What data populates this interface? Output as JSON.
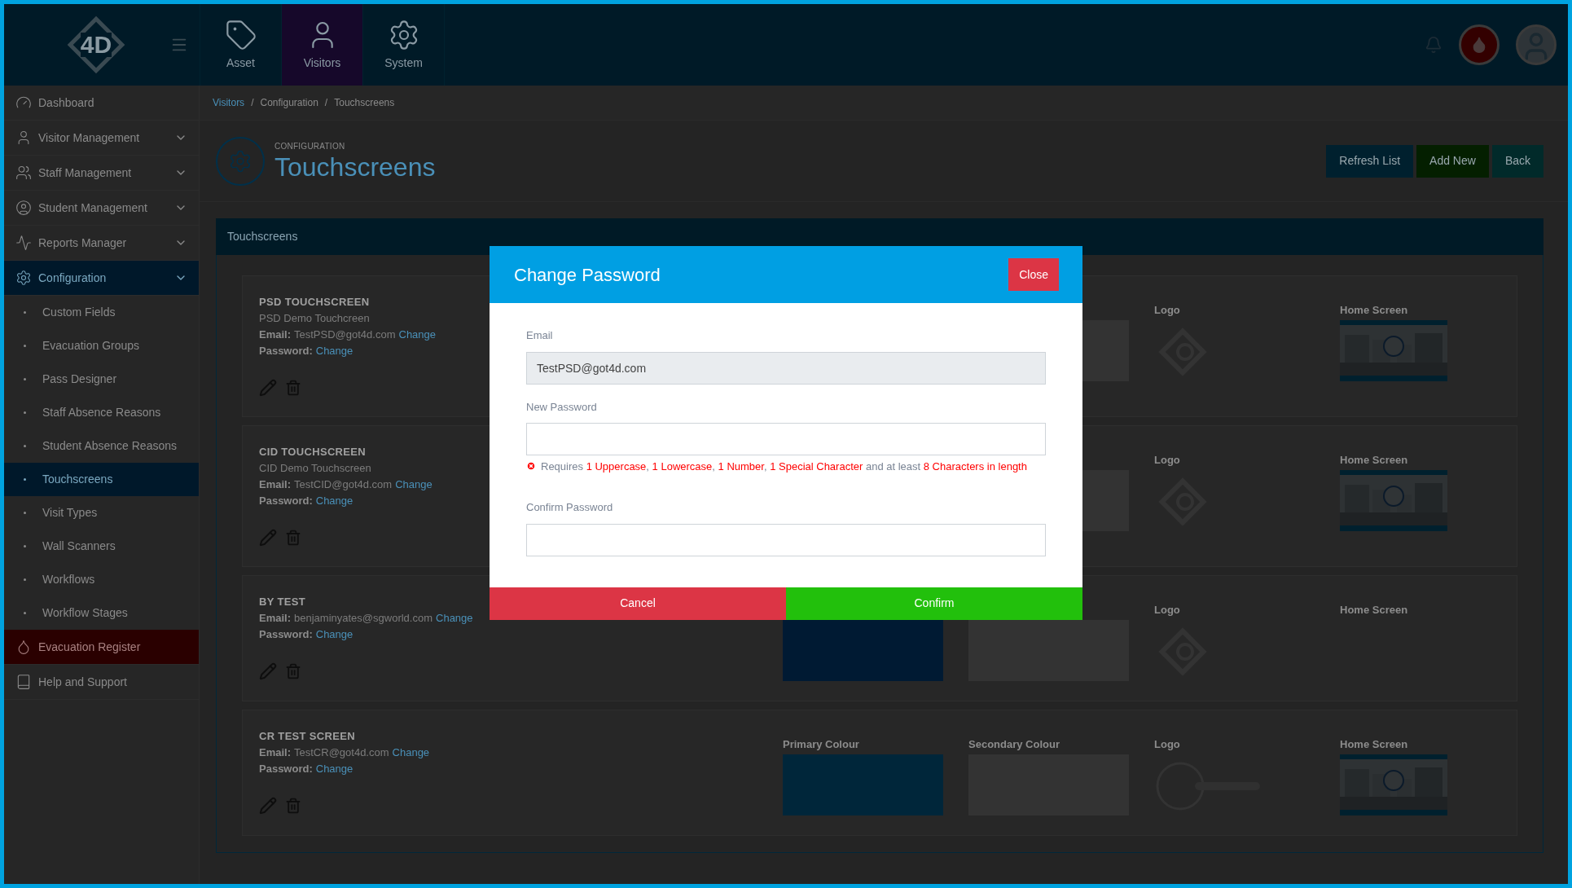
{
  "nav": {
    "logo_text": "4D",
    "tabs": [
      {
        "label": "Asset",
        "selected": false
      },
      {
        "label": "Visitors",
        "selected": true
      },
      {
        "label": "System",
        "selected": false
      }
    ]
  },
  "sidebar": {
    "items": [
      {
        "label": "Dashboard",
        "kind": "link",
        "selected": false
      },
      {
        "label": "Visitor Management",
        "kind": "group",
        "selected": false
      },
      {
        "label": "Staff Management",
        "kind": "group",
        "selected": false
      },
      {
        "label": "Student Management",
        "kind": "group",
        "selected": false
      },
      {
        "label": "Reports Manager",
        "kind": "group",
        "selected": false
      },
      {
        "label": "Configuration",
        "kind": "group",
        "selected": true,
        "children": [
          {
            "label": "Custom Fields",
            "selected": false
          },
          {
            "label": "Evacuation Groups",
            "selected": false
          },
          {
            "label": "Pass Designer",
            "selected": false
          },
          {
            "label": "Staff Absence Reasons",
            "selected": false
          },
          {
            "label": "Student Absence Reasons",
            "selected": false
          },
          {
            "label": "Touchscreens",
            "selected": true
          },
          {
            "label": "Visit Types",
            "selected": false
          },
          {
            "label": "Wall Scanners",
            "selected": false
          },
          {
            "label": "Workflows",
            "selected": false
          },
          {
            "label": "Workflow Stages",
            "selected": false
          }
        ]
      },
      {
        "label": "Evacuation Register",
        "kind": "alert",
        "selected": false
      },
      {
        "label": "Help and Support",
        "kind": "link",
        "selected": false
      }
    ]
  },
  "breadcrumb": [
    {
      "label": "Visitors",
      "link": true
    },
    {
      "separator": "/",
      "label": "Configuration",
      "link": false
    },
    {
      "separator": "/",
      "label": "Touchscreens",
      "link": false
    }
  ],
  "header": {
    "eyebrow": "CONFIGURATION",
    "title": "Touchscreens",
    "actions": [
      {
        "label": "Refresh List",
        "kind": "primary"
      },
      {
        "label": "Add New",
        "kind": "success"
      },
      {
        "label": "Back",
        "kind": "info"
      }
    ]
  },
  "panel": {
    "title": "Touchscreens",
    "cards": [
      {
        "name": "PSD TOUCHSCREEN",
        "description": "PSD Demo Touchcreen",
        "email_label": "Email:",
        "email": "TestPSD@got4d.com",
        "email_link": "Change",
        "password_label": "Password:",
        "password_link": "Change",
        "secondary_colour": {
          "color": "#333333"
        },
        "logo": {
          "label": "Logo",
          "kind": "diamond"
        },
        "home_screen": {
          "label": "Home Screen",
          "kind": "picture"
        }
      },
      {
        "name": "CID TOUCHSCREEN",
        "description": "CID Demo Touchscreen",
        "email_label": "Email:",
        "email": "TestCID@got4d.com",
        "email_link": "Change",
        "password_label": "Password:",
        "password_link": "Change",
        "secondary_colour": {
          "color": "#333333"
        },
        "logo": {
          "label": "Logo",
          "kind": "diamond"
        },
        "home_screen": {
          "label": "Home Screen",
          "kind": "picture"
        }
      },
      {
        "name": "BY TEST",
        "email_label": "Email:",
        "email": "benjaminyates@sgworld.com",
        "email_link": "Change",
        "password_label": "Password:",
        "password_link": "Change",
        "primary_colour": {
          "color": "#001a33"
        },
        "secondary_colour": {
          "color": "#333333"
        },
        "logo": {
          "label": "Logo",
          "kind": "diamond"
        },
        "home_screen": {
          "label": "Home Screen"
        }
      },
      {
        "name": "CR TEST SCREEN",
        "email_label": "Email:",
        "email": "TestCR@got4d.com",
        "email_link": "Change",
        "password_label": "Password:",
        "password_link": "Change",
        "primary_colour": {
          "label": "Primary Colour",
          "color": "#00263a"
        },
        "secondary_colour": {
          "label": "Secondary Colour",
          "color": "#333333"
        },
        "logo": {
          "label": "Logo",
          "kind": "ring"
        },
        "home_screen": {
          "label": "Home Screen",
          "kind": "picture"
        }
      }
    ]
  },
  "modal": {
    "title": "Change Password",
    "close": "Close",
    "fields": [
      {
        "label": "Email",
        "value": "TestPSD@got4d.com",
        "disabled": true
      },
      {
        "label": "New Password",
        "disabled": false,
        "hint": [
          {
            "text": "Requires ",
            "emphasis": false
          },
          {
            "text": "1 Uppercase",
            "emphasis": true
          },
          {
            "text": ", ",
            "emphasis": false
          },
          {
            "text": "1 Lowercase",
            "emphasis": true
          },
          {
            "text": ", ",
            "emphasis": false
          },
          {
            "text": "1 Number",
            "emphasis": true
          },
          {
            "text": ", ",
            "emphasis": false
          },
          {
            "text": "1 Special Character",
            "emphasis": true
          },
          {
            "text": " and at least ",
            "emphasis": false
          },
          {
            "text": "8 Characters in length",
            "emphasis": true
          }
        ]
      },
      {
        "label": "Confirm Password",
        "disabled": false
      }
    ],
    "buttons": [
      {
        "label": "Cancel",
        "kind": "danger"
      },
      {
        "label": "Confirm",
        "kind": "success"
      }
    ]
  }
}
